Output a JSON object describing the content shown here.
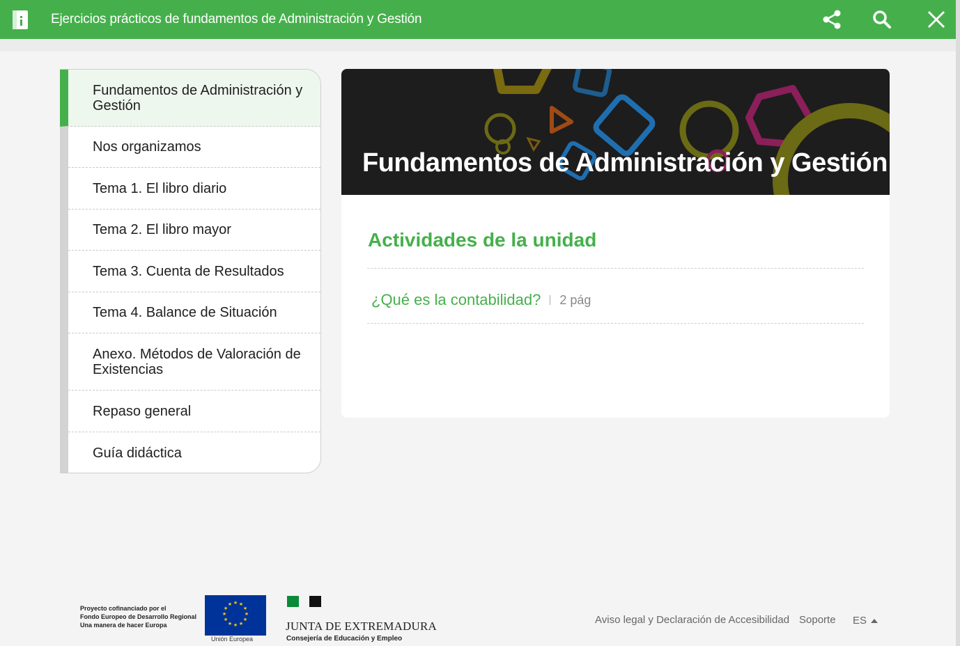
{
  "header": {
    "title": "Ejercicios prácticos de fundamentos de Administración y Gestión",
    "icons": [
      "book-icon",
      "share-icon",
      "search-icon",
      "close-icon"
    ],
    "color": "#45b04b"
  },
  "sidebar": {
    "items": [
      {
        "label": "Fundamentos de Administración y Gestión",
        "active": true
      },
      {
        "label": "Nos organizamos"
      },
      {
        "label": "Tema 1. El libro diario"
      },
      {
        "label": "Tema 2. El libro mayor"
      },
      {
        "label": "Tema 3. Cuenta de Resultados"
      },
      {
        "label": "Tema 4. Balance de Situación"
      },
      {
        "label": "Anexo. Métodos de Valoración de Existencias"
      },
      {
        "label": "Repaso general"
      },
      {
        "label": "Guía didáctica"
      }
    ]
  },
  "main": {
    "banner_title": "Fundamentos de Administración y Gestión",
    "section_title": "Actividades de la unidad",
    "activities": [
      {
        "title": "¿Qué es la contabilidad?",
        "pages": "2 pág"
      }
    ]
  },
  "footer": {
    "eu_text": [
      "Proyecto cofinanciado por el",
      "Fondo Europeo de Desarrollo Regional",
      "Una manera de hacer Europa"
    ],
    "eu_caption": "Unión Europea",
    "junta_name": "JUNTA DE EXTREMADURA",
    "junta_sub": "Consejería de Educación y Empleo",
    "legal_link": "Aviso legal y Declaración de Accesibilidad",
    "support_link": "Soporte",
    "language": "ES"
  }
}
